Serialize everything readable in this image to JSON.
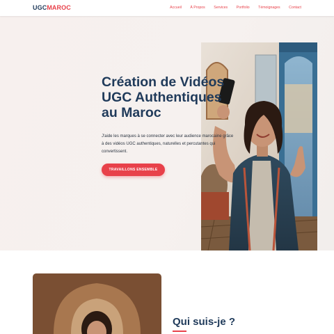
{
  "brand": {
    "part1": "UGC",
    "part2": "MAROC"
  },
  "nav": [
    "Accueil",
    "À Propos",
    "Services",
    "Portfolio",
    "Témoignages",
    "Contact"
  ],
  "hero": {
    "title": "Création de Vidéos UGC Authentiques au Maroc",
    "text": "J'aide les marques à se connecter avec leur audience marocaine grâce à des vidéos UGC authentiques, naturelles et percutantes qui convertissent.",
    "cta": "TRAVAILLONS ENSEMBLE"
  },
  "about": {
    "title": "Qui suis-je ?"
  },
  "colors": {
    "primary": "#1f3a5a",
    "accent": "#e8414a"
  }
}
